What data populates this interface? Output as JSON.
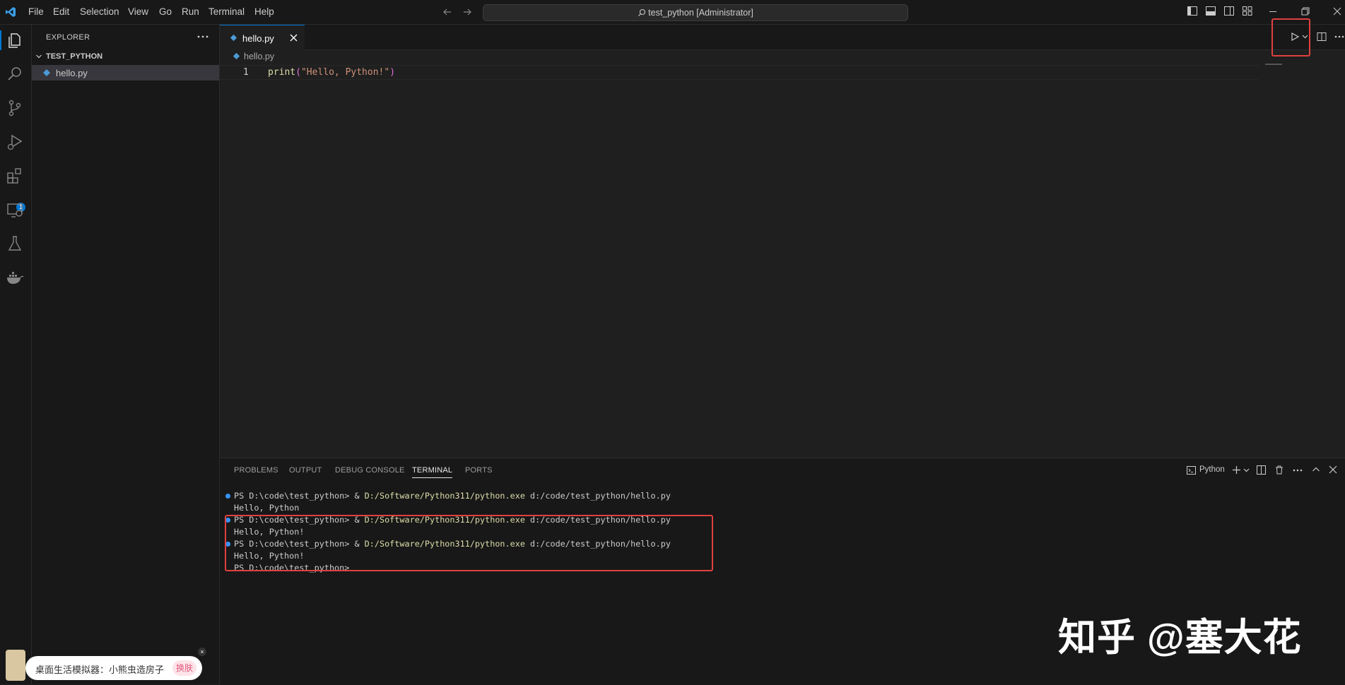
{
  "titlebar": {
    "menu": [
      "File",
      "Edit",
      "Selection",
      "View",
      "Go",
      "Run",
      "Terminal",
      "Help"
    ],
    "search_text": "test_python [Administrator]"
  },
  "sidebar": {
    "title": "EXPLORER",
    "folder": "TEST_PYTHON",
    "files": [
      "hello.py"
    ]
  },
  "editor": {
    "tab_label": "hello.py",
    "breadcrumb": "hello.py",
    "line_number": "1",
    "code_func": "print",
    "code_open": "(",
    "code_string": "\"Hello, Python!\"",
    "code_close": ")"
  },
  "activity": {
    "extensions_badge": "1"
  },
  "panel": {
    "tabs": [
      "PROBLEMS",
      "OUTPUT",
      "DEBUG CONSOLE",
      "TERMINAL",
      "PORTS"
    ],
    "active_tab": "TERMINAL",
    "terminal_name": "Python",
    "lines": [
      {
        "prompt": "PS D:\\code\\test_python> & ",
        "exe": "D:/Software/Python311/python.exe",
        "arg": " d:/code/test_python/hello.py"
      },
      {
        "output": "Hello, Python"
      },
      {
        "prompt": "PS D:\\code\\test_python> & ",
        "exe": "D:/Software/Python311/python.exe",
        "arg": " d:/code/test_python/hello.py"
      },
      {
        "output": "Hello, Python!"
      },
      {
        "prompt": "PS D:\\code\\test_python> & ",
        "exe": "D:/Software/Python311/python.exe",
        "arg": " d:/code/test_python/hello.py"
      },
      {
        "output": "Hello, Python!"
      },
      {
        "output": "PS D:\\code\\test_python>"
      }
    ]
  },
  "watermark": "知乎 @塞大花",
  "toast": {
    "text": "桌面生活模拟器：小熊虫造房子",
    "button": "换肤"
  },
  "colors": {
    "accent": "#0078d4",
    "highlight": "#e04040",
    "string": "#ce9178",
    "function": "#dcdcaa"
  }
}
